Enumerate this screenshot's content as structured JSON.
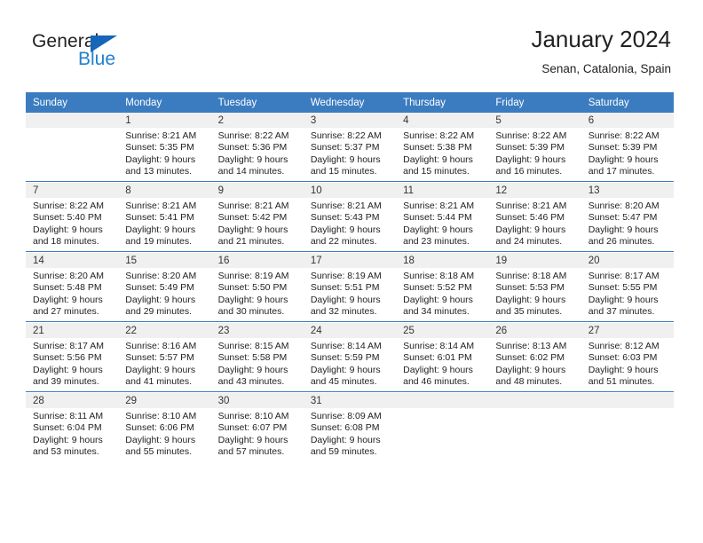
{
  "brand": {
    "name_part1": "General",
    "name_part2": "Blue",
    "triangle_color": "#1565b8",
    "blue_color": "#2081d0"
  },
  "header": {
    "title": "January 2024",
    "subtitle": "Senan, Catalonia, Spain"
  },
  "theme": {
    "header_row_bg": "#3b7cc0",
    "daynum_band_bg": "#f0f0f0",
    "separator_color": "#3b7cc0"
  },
  "calendar": {
    "weekday_headers": [
      "Sunday",
      "Monday",
      "Tuesday",
      "Wednesday",
      "Thursday",
      "Friday",
      "Saturday"
    ],
    "weeks": [
      [
        {
          "day": "",
          "sunrise": "",
          "sunset": "",
          "daylight_line1": "",
          "daylight_line2": ""
        },
        {
          "day": "1",
          "sunrise": "Sunrise: 8:21 AM",
          "sunset": "Sunset: 5:35 PM",
          "daylight_line1": "Daylight: 9 hours",
          "daylight_line2": "and 13 minutes."
        },
        {
          "day": "2",
          "sunrise": "Sunrise: 8:22 AM",
          "sunset": "Sunset: 5:36 PM",
          "daylight_line1": "Daylight: 9 hours",
          "daylight_line2": "and 14 minutes."
        },
        {
          "day": "3",
          "sunrise": "Sunrise: 8:22 AM",
          "sunset": "Sunset: 5:37 PM",
          "daylight_line1": "Daylight: 9 hours",
          "daylight_line2": "and 15 minutes."
        },
        {
          "day": "4",
          "sunrise": "Sunrise: 8:22 AM",
          "sunset": "Sunset: 5:38 PM",
          "daylight_line1": "Daylight: 9 hours",
          "daylight_line2": "and 15 minutes."
        },
        {
          "day": "5",
          "sunrise": "Sunrise: 8:22 AM",
          "sunset": "Sunset: 5:39 PM",
          "daylight_line1": "Daylight: 9 hours",
          "daylight_line2": "and 16 minutes."
        },
        {
          "day": "6",
          "sunrise": "Sunrise: 8:22 AM",
          "sunset": "Sunset: 5:39 PM",
          "daylight_line1": "Daylight: 9 hours",
          "daylight_line2": "and 17 minutes."
        }
      ],
      [
        {
          "day": "7",
          "sunrise": "Sunrise: 8:22 AM",
          "sunset": "Sunset: 5:40 PM",
          "daylight_line1": "Daylight: 9 hours",
          "daylight_line2": "and 18 minutes."
        },
        {
          "day": "8",
          "sunrise": "Sunrise: 8:21 AM",
          "sunset": "Sunset: 5:41 PM",
          "daylight_line1": "Daylight: 9 hours",
          "daylight_line2": "and 19 minutes."
        },
        {
          "day": "9",
          "sunrise": "Sunrise: 8:21 AM",
          "sunset": "Sunset: 5:42 PM",
          "daylight_line1": "Daylight: 9 hours",
          "daylight_line2": "and 21 minutes."
        },
        {
          "day": "10",
          "sunrise": "Sunrise: 8:21 AM",
          "sunset": "Sunset: 5:43 PM",
          "daylight_line1": "Daylight: 9 hours",
          "daylight_line2": "and 22 minutes."
        },
        {
          "day": "11",
          "sunrise": "Sunrise: 8:21 AM",
          "sunset": "Sunset: 5:44 PM",
          "daylight_line1": "Daylight: 9 hours",
          "daylight_line2": "and 23 minutes."
        },
        {
          "day": "12",
          "sunrise": "Sunrise: 8:21 AM",
          "sunset": "Sunset: 5:46 PM",
          "daylight_line1": "Daylight: 9 hours",
          "daylight_line2": "and 24 minutes."
        },
        {
          "day": "13",
          "sunrise": "Sunrise: 8:20 AM",
          "sunset": "Sunset: 5:47 PM",
          "daylight_line1": "Daylight: 9 hours",
          "daylight_line2": "and 26 minutes."
        }
      ],
      [
        {
          "day": "14",
          "sunrise": "Sunrise: 8:20 AM",
          "sunset": "Sunset: 5:48 PM",
          "daylight_line1": "Daylight: 9 hours",
          "daylight_line2": "and 27 minutes."
        },
        {
          "day": "15",
          "sunrise": "Sunrise: 8:20 AM",
          "sunset": "Sunset: 5:49 PM",
          "daylight_line1": "Daylight: 9 hours",
          "daylight_line2": "and 29 minutes."
        },
        {
          "day": "16",
          "sunrise": "Sunrise: 8:19 AM",
          "sunset": "Sunset: 5:50 PM",
          "daylight_line1": "Daylight: 9 hours",
          "daylight_line2": "and 30 minutes."
        },
        {
          "day": "17",
          "sunrise": "Sunrise: 8:19 AM",
          "sunset": "Sunset: 5:51 PM",
          "daylight_line1": "Daylight: 9 hours",
          "daylight_line2": "and 32 minutes."
        },
        {
          "day": "18",
          "sunrise": "Sunrise: 8:18 AM",
          "sunset": "Sunset: 5:52 PM",
          "daylight_line1": "Daylight: 9 hours",
          "daylight_line2": "and 34 minutes."
        },
        {
          "day": "19",
          "sunrise": "Sunrise: 8:18 AM",
          "sunset": "Sunset: 5:53 PM",
          "daylight_line1": "Daylight: 9 hours",
          "daylight_line2": "and 35 minutes."
        },
        {
          "day": "20",
          "sunrise": "Sunrise: 8:17 AM",
          "sunset": "Sunset: 5:55 PM",
          "daylight_line1": "Daylight: 9 hours",
          "daylight_line2": "and 37 minutes."
        }
      ],
      [
        {
          "day": "21",
          "sunrise": "Sunrise: 8:17 AM",
          "sunset": "Sunset: 5:56 PM",
          "daylight_line1": "Daylight: 9 hours",
          "daylight_line2": "and 39 minutes."
        },
        {
          "day": "22",
          "sunrise": "Sunrise: 8:16 AM",
          "sunset": "Sunset: 5:57 PM",
          "daylight_line1": "Daylight: 9 hours",
          "daylight_line2": "and 41 minutes."
        },
        {
          "day": "23",
          "sunrise": "Sunrise: 8:15 AM",
          "sunset": "Sunset: 5:58 PM",
          "daylight_line1": "Daylight: 9 hours",
          "daylight_line2": "and 43 minutes."
        },
        {
          "day": "24",
          "sunrise": "Sunrise: 8:14 AM",
          "sunset": "Sunset: 5:59 PM",
          "daylight_line1": "Daylight: 9 hours",
          "daylight_line2": "and 45 minutes."
        },
        {
          "day": "25",
          "sunrise": "Sunrise: 8:14 AM",
          "sunset": "Sunset: 6:01 PM",
          "daylight_line1": "Daylight: 9 hours",
          "daylight_line2": "and 46 minutes."
        },
        {
          "day": "26",
          "sunrise": "Sunrise: 8:13 AM",
          "sunset": "Sunset: 6:02 PM",
          "daylight_line1": "Daylight: 9 hours",
          "daylight_line2": "and 48 minutes."
        },
        {
          "day": "27",
          "sunrise": "Sunrise: 8:12 AM",
          "sunset": "Sunset: 6:03 PM",
          "daylight_line1": "Daylight: 9 hours",
          "daylight_line2": "and 51 minutes."
        }
      ],
      [
        {
          "day": "28",
          "sunrise": "Sunrise: 8:11 AM",
          "sunset": "Sunset: 6:04 PM",
          "daylight_line1": "Daylight: 9 hours",
          "daylight_line2": "and 53 minutes."
        },
        {
          "day": "29",
          "sunrise": "Sunrise: 8:10 AM",
          "sunset": "Sunset: 6:06 PM",
          "daylight_line1": "Daylight: 9 hours",
          "daylight_line2": "and 55 minutes."
        },
        {
          "day": "30",
          "sunrise": "Sunrise: 8:10 AM",
          "sunset": "Sunset: 6:07 PM",
          "daylight_line1": "Daylight: 9 hours",
          "daylight_line2": "and 57 minutes."
        },
        {
          "day": "31",
          "sunrise": "Sunrise: 8:09 AM",
          "sunset": "Sunset: 6:08 PM",
          "daylight_line1": "Daylight: 9 hours",
          "daylight_line2": "and 59 minutes."
        },
        {
          "day": "",
          "sunrise": "",
          "sunset": "",
          "daylight_line1": "",
          "daylight_line2": ""
        },
        {
          "day": "",
          "sunrise": "",
          "sunset": "",
          "daylight_line1": "",
          "daylight_line2": ""
        },
        {
          "day": "",
          "sunrise": "",
          "sunset": "",
          "daylight_line1": "",
          "daylight_line2": ""
        }
      ]
    ]
  }
}
